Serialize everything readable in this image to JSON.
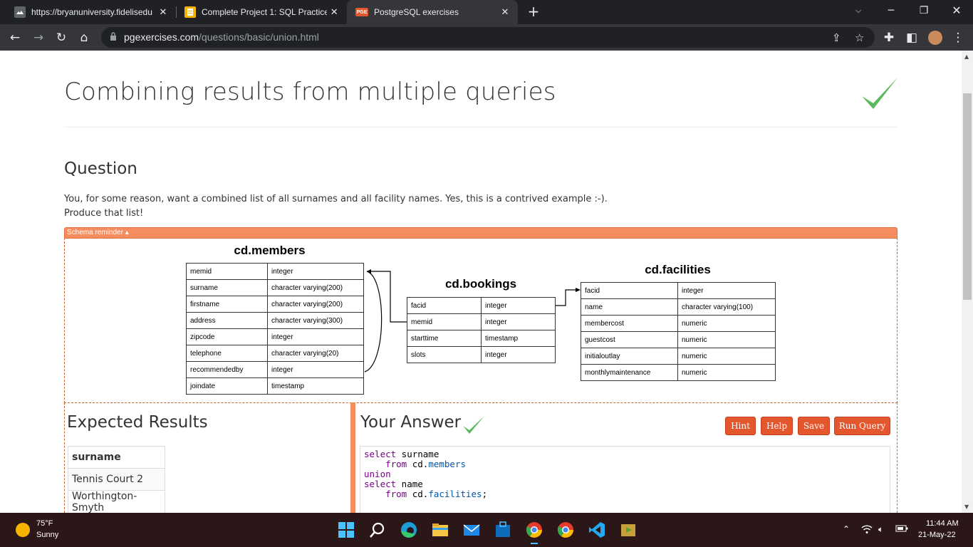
{
  "browser": {
    "tabs": [
      {
        "title": "https://bryanuniversity.fidelisedu",
        "favicon": "cloud-icon"
      },
      {
        "title": "Complete Project 1: SQL Practice",
        "favicon": "document-icon"
      },
      {
        "title": "PostgreSQL exercises",
        "favicon": "pge-icon",
        "favicon_text": "PGE"
      }
    ],
    "url_host": "pgexercises.com",
    "url_path": "/questions/basic/union.html"
  },
  "page": {
    "title": "Combining results from multiple queries",
    "question_heading": "Question",
    "question_line1": "You, for some reason, want a combined list of all surnames and all facility names. Yes, this is a contrived example :-).",
    "question_line2": "Produce that list!",
    "schema_reminder": "Schema reminder ▴"
  },
  "schema": {
    "members": {
      "title": "cd.members",
      "rows": [
        [
          "memid",
          "integer"
        ],
        [
          "surname",
          "character varying(200)"
        ],
        [
          "firstname",
          "character varying(200)"
        ],
        [
          "address",
          "character varying(300)"
        ],
        [
          "zipcode",
          "integer"
        ],
        [
          "telephone",
          "character varying(20)"
        ],
        [
          "recommendedby",
          "integer"
        ],
        [
          "joindate",
          "timestamp"
        ]
      ]
    },
    "bookings": {
      "title": "cd.bookings",
      "rows": [
        [
          "facid",
          "integer"
        ],
        [
          "memid",
          "integer"
        ],
        [
          "starttime",
          "timestamp"
        ],
        [
          "slots",
          "integer"
        ]
      ]
    },
    "facilities": {
      "title": "cd.facilities",
      "rows": [
        [
          "facid",
          "integer"
        ],
        [
          "name",
          "character varying(100)"
        ],
        [
          "membercost",
          "numeric"
        ],
        [
          "guestcost",
          "numeric"
        ],
        [
          "initialoutlay",
          "numeric"
        ],
        [
          "monthlymaintenance",
          "numeric"
        ]
      ]
    }
  },
  "expected": {
    "heading": "Expected Results",
    "column": "surname",
    "rows": [
      "Tennis Court 2",
      "Worthington-Smyth"
    ]
  },
  "answer": {
    "heading": "Your Answer",
    "buttons": {
      "hint": "Hint",
      "help": "Help",
      "save": "Save",
      "run": "Run Query"
    },
    "code_lines": [
      [
        {
          "t": "select",
          "c": "kw"
        },
        {
          "t": " surname",
          "c": ""
        }
      ],
      [
        {
          "t": "    ",
          "c": ""
        },
        {
          "t": "from",
          "c": "kw"
        },
        {
          "t": " cd.",
          "c": ""
        },
        {
          "t": "members",
          "c": "prop"
        }
      ],
      [
        {
          "t": "union",
          "c": "kw"
        }
      ],
      [
        {
          "t": "select",
          "c": "kw"
        },
        {
          "t": " name",
          "c": ""
        }
      ],
      [
        {
          "t": "    ",
          "c": ""
        },
        {
          "t": "from",
          "c": "kw"
        },
        {
          "t": " cd.",
          "c": ""
        },
        {
          "t": "facilities",
          "c": "prop"
        },
        {
          "t": ";",
          "c": ""
        }
      ]
    ]
  },
  "taskbar": {
    "temperature": "75°F",
    "condition": "Sunny",
    "time": "11:44 AM",
    "date": "21-May-22"
  },
  "colors": {
    "accent": "#f68d5f",
    "button": "#e4572e",
    "check": "#5cb85c"
  }
}
